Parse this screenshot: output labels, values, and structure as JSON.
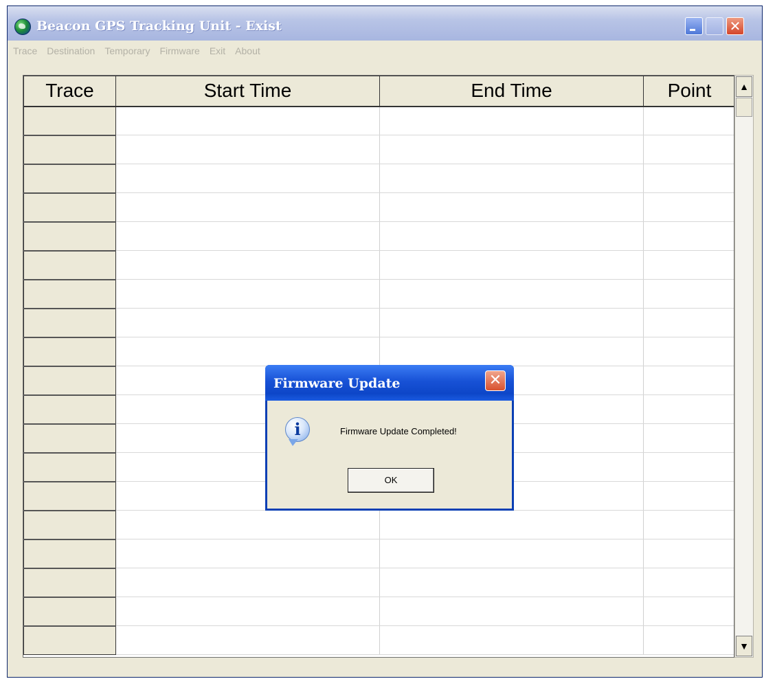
{
  "window": {
    "title": "Beacon GPS Tracking Unit - Exist"
  },
  "menubar": {
    "items": [
      "Trace",
      "Destination",
      "Temporary",
      "Firmware",
      "Exit",
      "About"
    ]
  },
  "table": {
    "columns": [
      "Trace",
      "Start Time",
      "End Time",
      "Point"
    ],
    "visible_row_count": 19
  },
  "dialog": {
    "title": "Firmware Update",
    "message": "Firmware Update Completed!",
    "ok_label": "OK",
    "close_glyph": "✕",
    "icon": "info-icon"
  },
  "colors": {
    "xp_blue": "#0a3fb4",
    "window_bg": "#ece9d8",
    "close_red": "#d8512f"
  }
}
